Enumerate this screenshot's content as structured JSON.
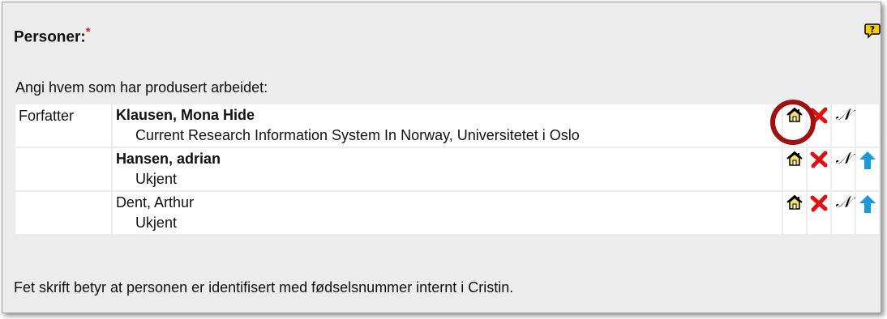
{
  "section": {
    "title": "Personer:",
    "required_mark": "*",
    "help_icon": "comment-question-icon"
  },
  "intro_text": "Angi hvem som har produsert arbeidet:",
  "persons": [
    {
      "role": "Forfatter",
      "name": "Klausen, Mona Hide",
      "bold": true,
      "affiliation": "Current Research Information System In Norway, Universitetet i Oslo",
      "actions": [
        "home-icon",
        "delete-x-icon",
        "n-icon"
      ],
      "highlighted": true
    },
    {
      "role": "",
      "name": "Hansen, adrian",
      "bold": true,
      "affiliation": "Ukjent",
      "actions": [
        "home-icon",
        "delete-x-icon",
        "n-icon",
        "move-up-arrow-icon"
      ]
    },
    {
      "role": "",
      "name": "Dent, Arthur",
      "bold": false,
      "affiliation": "Ukjent",
      "actions": [
        "home-icon",
        "delete-x-icon",
        "n-icon",
        "move-up-arrow-icon"
      ]
    }
  ],
  "footer_text": "Fet skrift betyr at personen er identifisert med fødselsnummer internt i Cristin.",
  "colors": {
    "panel_bg": "#ececec",
    "delete_red": "#e01010",
    "arrow_blue": "#1a9ad8",
    "highlight_ring": "#a01010"
  }
}
